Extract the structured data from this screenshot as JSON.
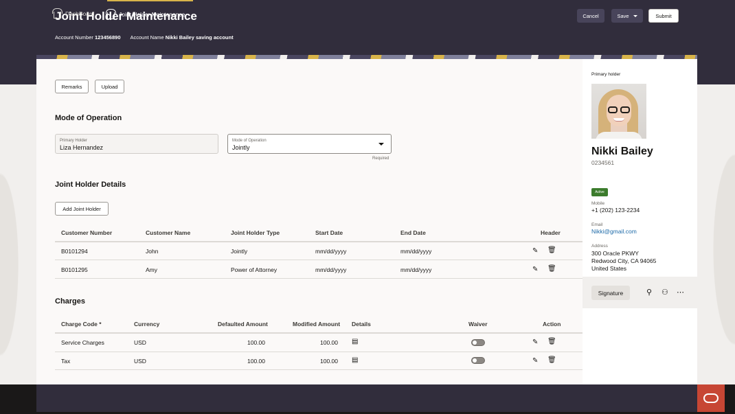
{
  "header": {
    "title": "Joint Holder Maintenance",
    "account_number_label": "Account Number",
    "account_number": "123456890",
    "account_name_label": "Account Name",
    "account_name": "Nikki Bailey saving account",
    "cancel": "Cancel",
    "save": "Save",
    "submit": "Submit"
  },
  "actions": {
    "remarks": "Remarks",
    "upload": "Upload"
  },
  "mode_section": {
    "title": "Mode of Operation",
    "primary_holder_label": "Primary Holder",
    "primary_holder_value": "Liza Hernandez",
    "mode_label": "Mode of Operation",
    "mode_value": "Jointly",
    "required": "Required"
  },
  "joint": {
    "title": "Joint Holder Details",
    "add_button": "Add Joint Holder",
    "columns": [
      "Customer Number",
      "Customer Name",
      "Joint Holder Type",
      "Start Date",
      "End Date",
      "Header"
    ],
    "rows": [
      {
        "number": "B0101294",
        "name": "John",
        "type": "Jointly",
        "start": "mm/dd/yyyy",
        "end": "mm/dd/yyyy"
      },
      {
        "number": "B0101295",
        "name": "Amy",
        "type": "Power of Attorney",
        "start": "mm/dd/yyyy",
        "end": "mm/dd/yyyy"
      }
    ]
  },
  "charges": {
    "title": "Charges",
    "columns": [
      "Charge Code",
      "Currency",
      "Defaulted Amount",
      "Modified Amount",
      "Details",
      "Waiver",
      "Action"
    ],
    "required_mark": "*",
    "rows": [
      {
        "code": "Service Charges",
        "currency": "USD",
        "defaulted": "100.00",
        "modified": "100.00",
        "waiver": false
      },
      {
        "code": "Tax",
        "currency": "USD",
        "defaulted": "100.00",
        "modified": "100.00",
        "waiver": false
      }
    ]
  },
  "profile": {
    "section_label": "Primary holder",
    "name": "Nikki Bailey",
    "id": "0234561",
    "status": "Active",
    "mobile_label": "Mobile",
    "mobile": "+1 (202) 123-2234",
    "email_label": "Email",
    "email": "Nikki@gmail.com",
    "address_label": "Address",
    "address_line1": "300 Oracle PKWY",
    "address_line2": "Redwood City, CA 94065",
    "address_line3": "United States",
    "signature": "Signature"
  },
  "footer": {
    "tabs": [
      "DashBoard",
      "Joint Holder Maintenance"
    ]
  },
  "colors": {
    "header_bg": "#312d3c",
    "active_badge": "#3c7c2d",
    "accent": "#d8b44a",
    "brand": "#c74634",
    "link": "#1d6aa8"
  }
}
